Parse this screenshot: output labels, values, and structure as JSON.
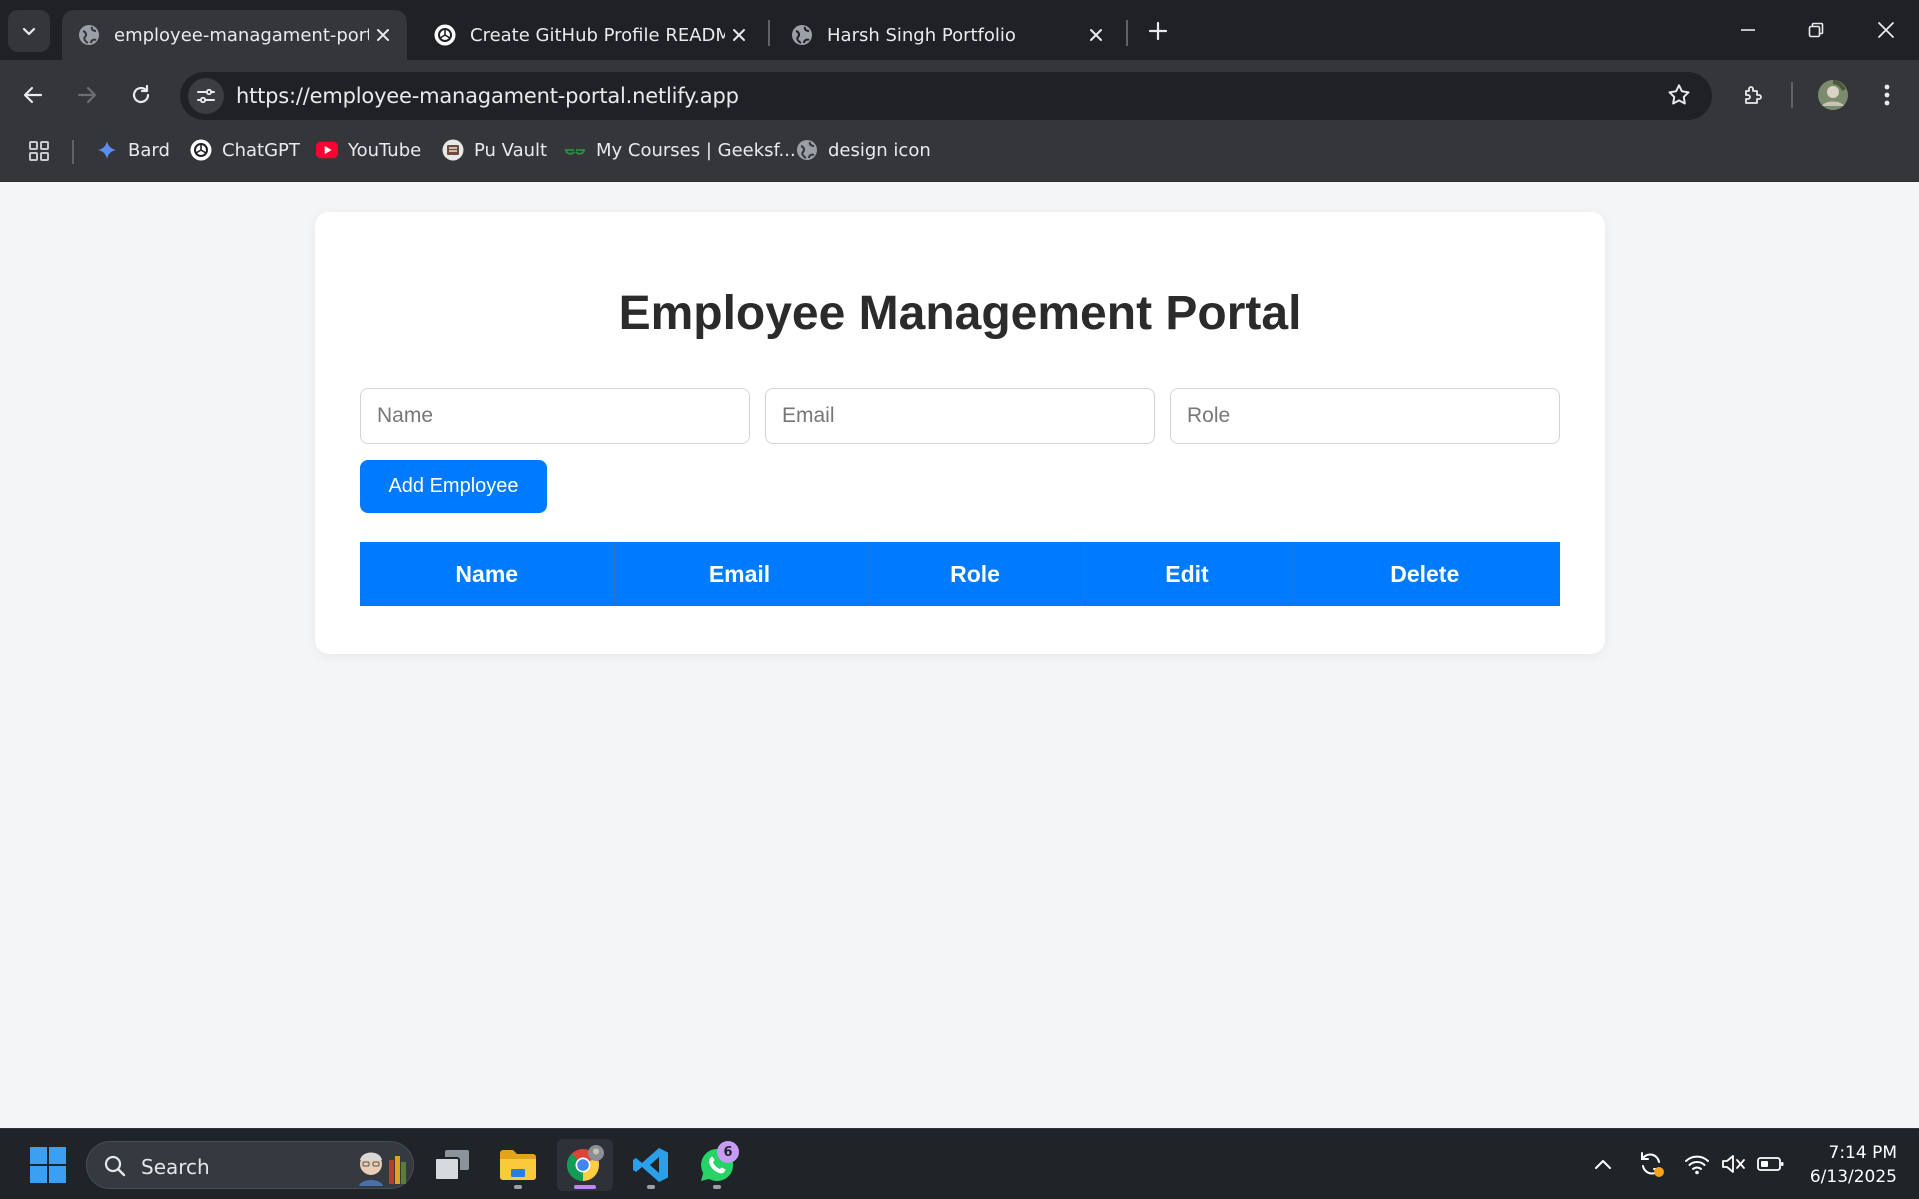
{
  "browser": {
    "tabs": [
      {
        "title": "employee-managament-portal",
        "active": true,
        "favicon": "globe-icon"
      },
      {
        "title": "Create GitHub Profile README",
        "active": false,
        "favicon": "chatgpt-icon"
      },
      {
        "title": "Harsh Singh Portfolio",
        "active": false,
        "favicon": "globe-icon"
      }
    ],
    "url": "https://employee-managament-portal.netlify.app",
    "bookmarks": [
      {
        "label": "Bard",
        "icon": "bard-sparkle-icon"
      },
      {
        "label": "ChatGPT",
        "icon": "chatgpt-icon"
      },
      {
        "label": "YouTube",
        "icon": "youtube-icon"
      },
      {
        "label": "Pu Vault",
        "icon": "pu-vault-icon"
      },
      {
        "label": "My Courses | Geeksf...",
        "icon": "geeksforgeeks-icon"
      },
      {
        "label": "design icon",
        "icon": "globe-icon"
      }
    ]
  },
  "page": {
    "title": "Employee Management Portal",
    "form": {
      "name_placeholder": "Name",
      "email_placeholder": "Email",
      "role_placeholder": "Role",
      "name_value": "",
      "email_value": "",
      "role_value": "",
      "add_button": "Add Employee"
    },
    "table": {
      "headers": [
        "Name",
        "Email",
        "Role",
        "Edit",
        "Delete"
      ],
      "rows": []
    },
    "colors": {
      "accent": "#007bff",
      "background": "#f4f5f7",
      "card": "#ffffff"
    }
  },
  "taskbar": {
    "search_label": "Search",
    "time": "7:14 PM",
    "date": "6/13/2025",
    "whatsapp_badge": "6"
  }
}
